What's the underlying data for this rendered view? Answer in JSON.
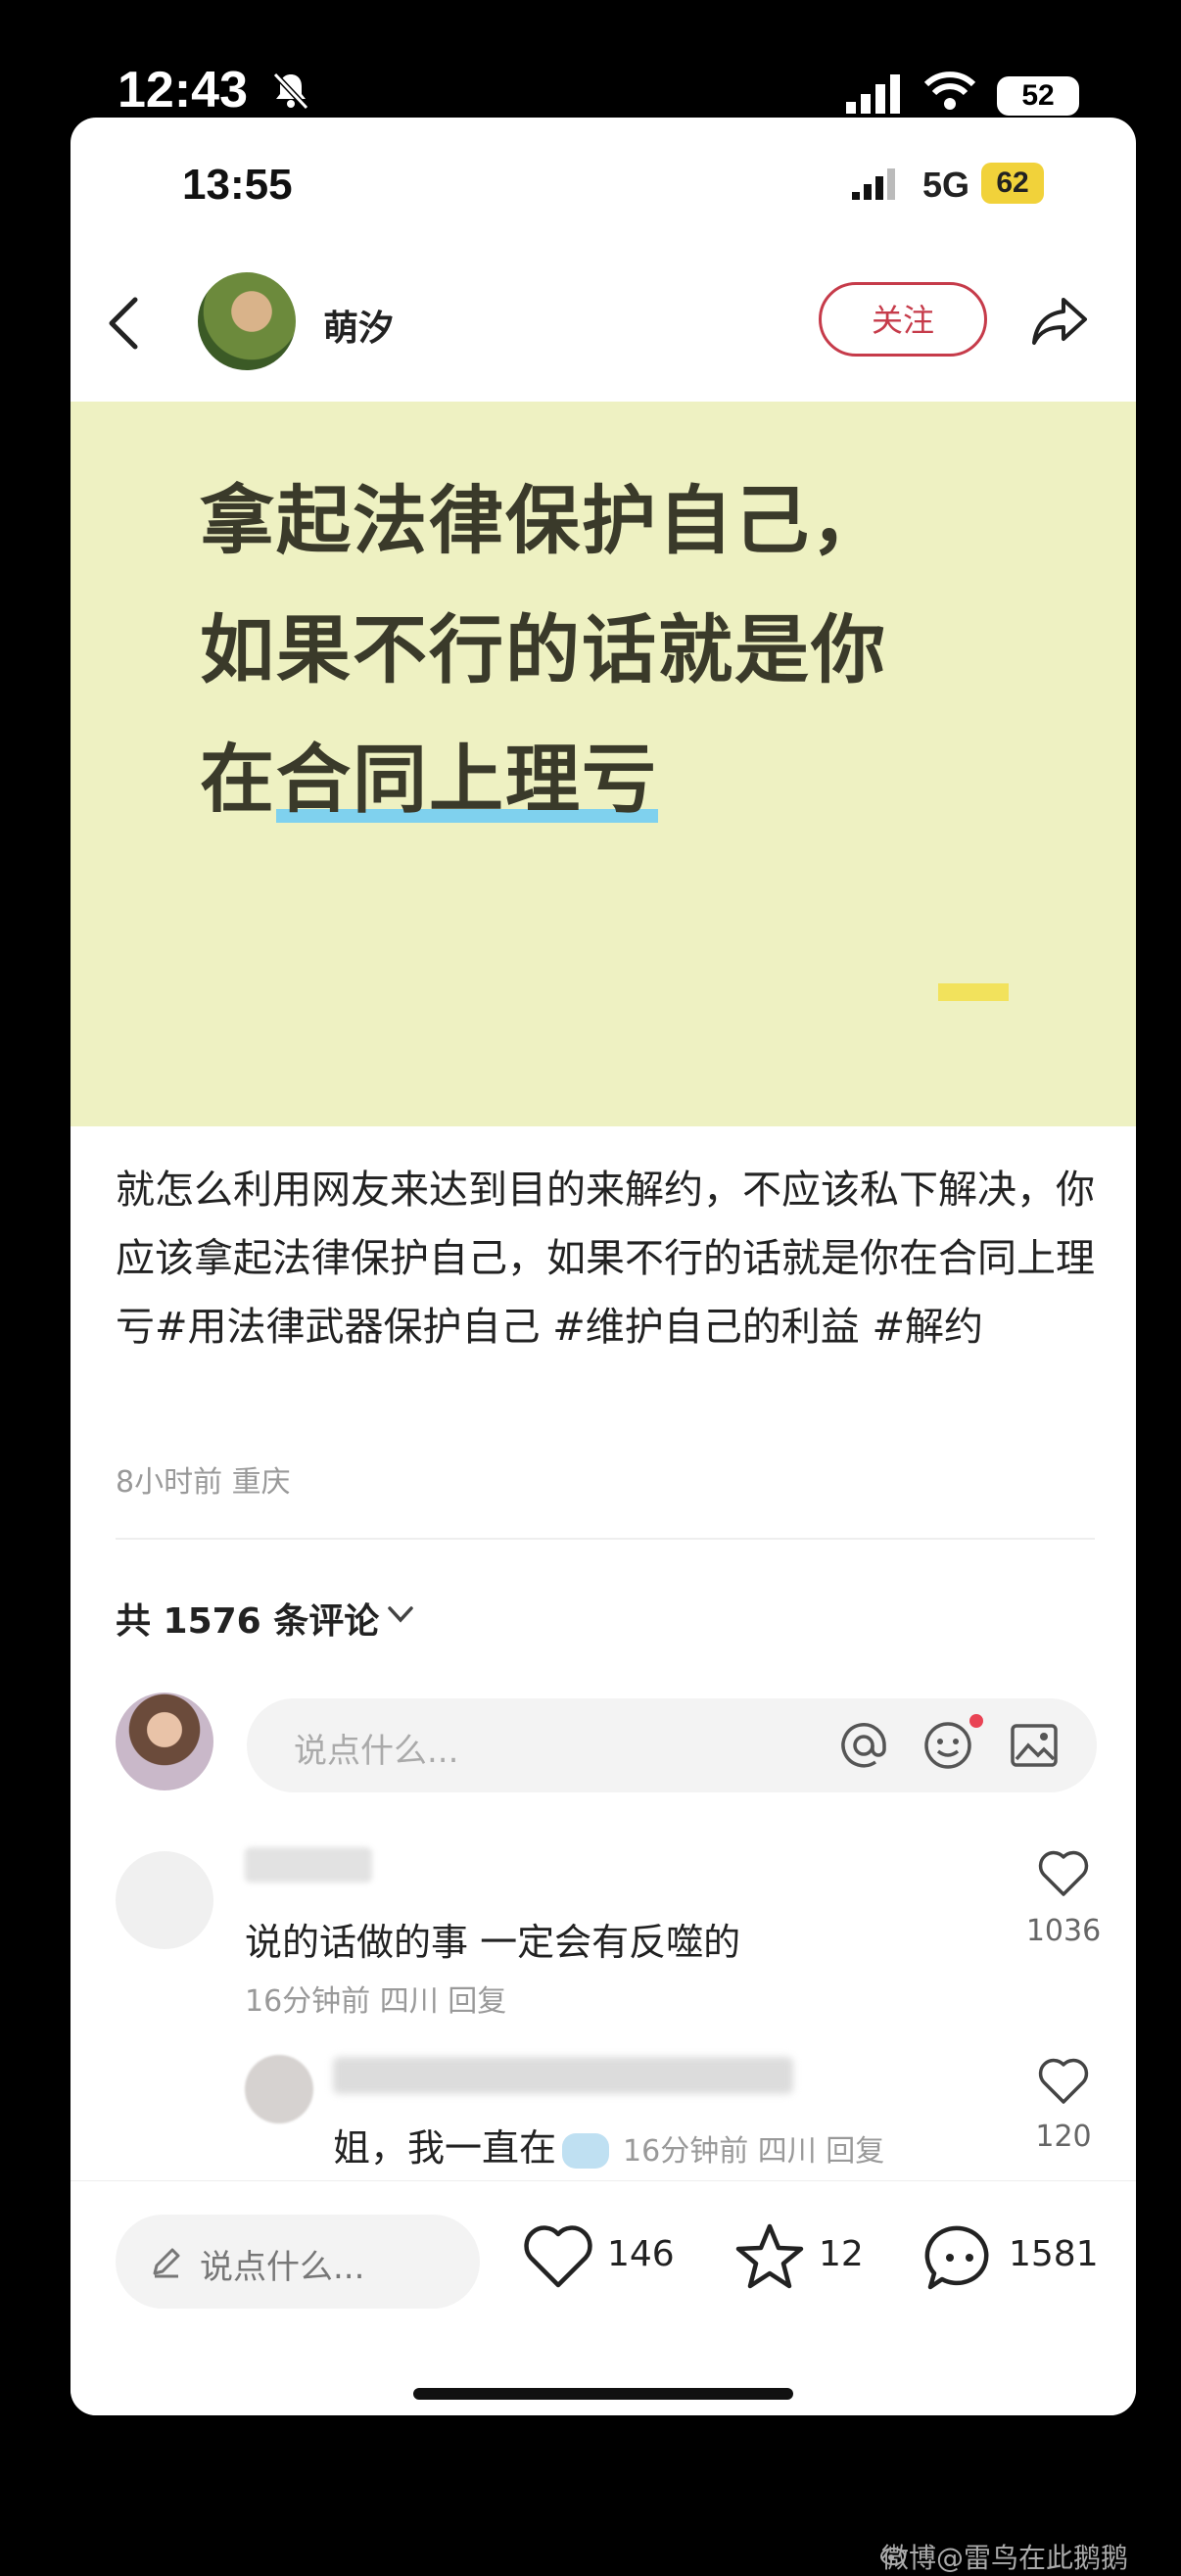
{
  "outer_status": {
    "time": "12:43",
    "battery": "52"
  },
  "inner_status": {
    "time": "13:55",
    "network": "5G",
    "battery": "62"
  },
  "header": {
    "username": "萌汐",
    "follow_label": "关注"
  },
  "banner": {
    "line1": "拿起法律保护自己，",
    "line2": "如果不行的话就是你",
    "line3_prefix": "在",
    "line3_highlight": "合同上理亏"
  },
  "post": {
    "description": "就怎么利用网友来达到目的来解约，不应该私下解决，你应该拿起法律保护自己，如果不行的话就是你在合同上理亏#用法律武器保护自己 #维护自己的利益 #解约",
    "meta": "8小时前 重庆"
  },
  "comments_section": {
    "count_label": "共 1576 条评论",
    "input_placeholder": "说点什么..."
  },
  "comments": [
    {
      "text": "说的话做的事 一定会有反噬的",
      "meta": "16分钟前 四川 回复",
      "likes": "1036"
    }
  ],
  "replies": [
    {
      "text": "姐，我一直在",
      "meta": "16分钟前 四川 回复",
      "likes": "120"
    }
  ],
  "bottom_bar": {
    "input_placeholder": "说点什么...",
    "likes": "146",
    "favorites": "12",
    "comments": "1581"
  },
  "watermark": "微博@雷鸟在此鹅鹅",
  "icons": {
    "back": "back-arrow-icon",
    "share": "share-icon",
    "at": "at-icon",
    "emoji": "emoji-icon",
    "image": "image-icon",
    "heart": "heart-icon",
    "star": "star-icon",
    "chat": "chat-bubble-icon",
    "pencil": "pencil-icon"
  },
  "colors": {
    "accent": "#c63b4a",
    "banner_bg": "#eef1c2",
    "highlight": "#7fd1ee"
  }
}
